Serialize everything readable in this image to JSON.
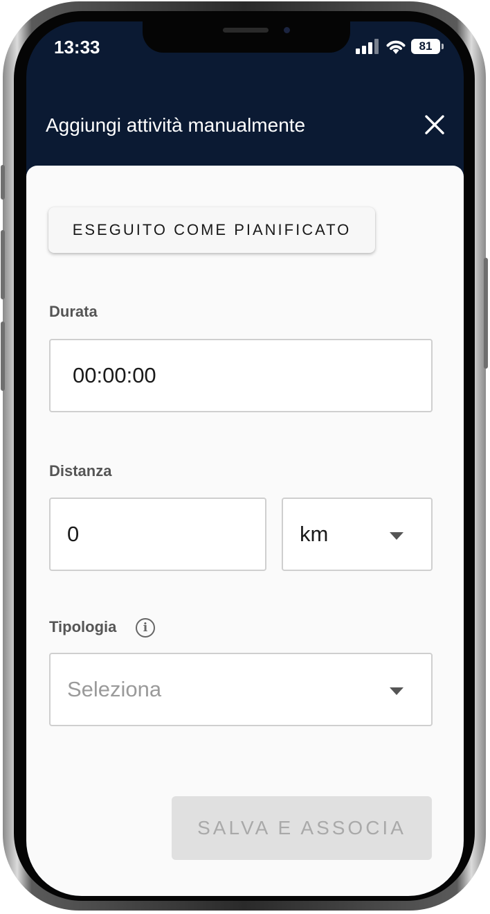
{
  "status_bar": {
    "time": "13:33",
    "battery": "81"
  },
  "header": {
    "title": "Aggiungi attività manualmente"
  },
  "form": {
    "planned_button": "ESEGUITO COME PIANIFICATO",
    "duration": {
      "label": "Durata",
      "value": "00:00:00"
    },
    "distance": {
      "label": "Distanza",
      "value": "0",
      "unit": "km"
    },
    "type": {
      "label": "Tipologia",
      "placeholder": "Seleziona"
    },
    "save_button": "SALVA E ASSOCIA"
  },
  "colors": {
    "header_bg": "#0b1a33",
    "sheet_bg": "#fafafa",
    "disabled_button": "#e0e0e0"
  }
}
